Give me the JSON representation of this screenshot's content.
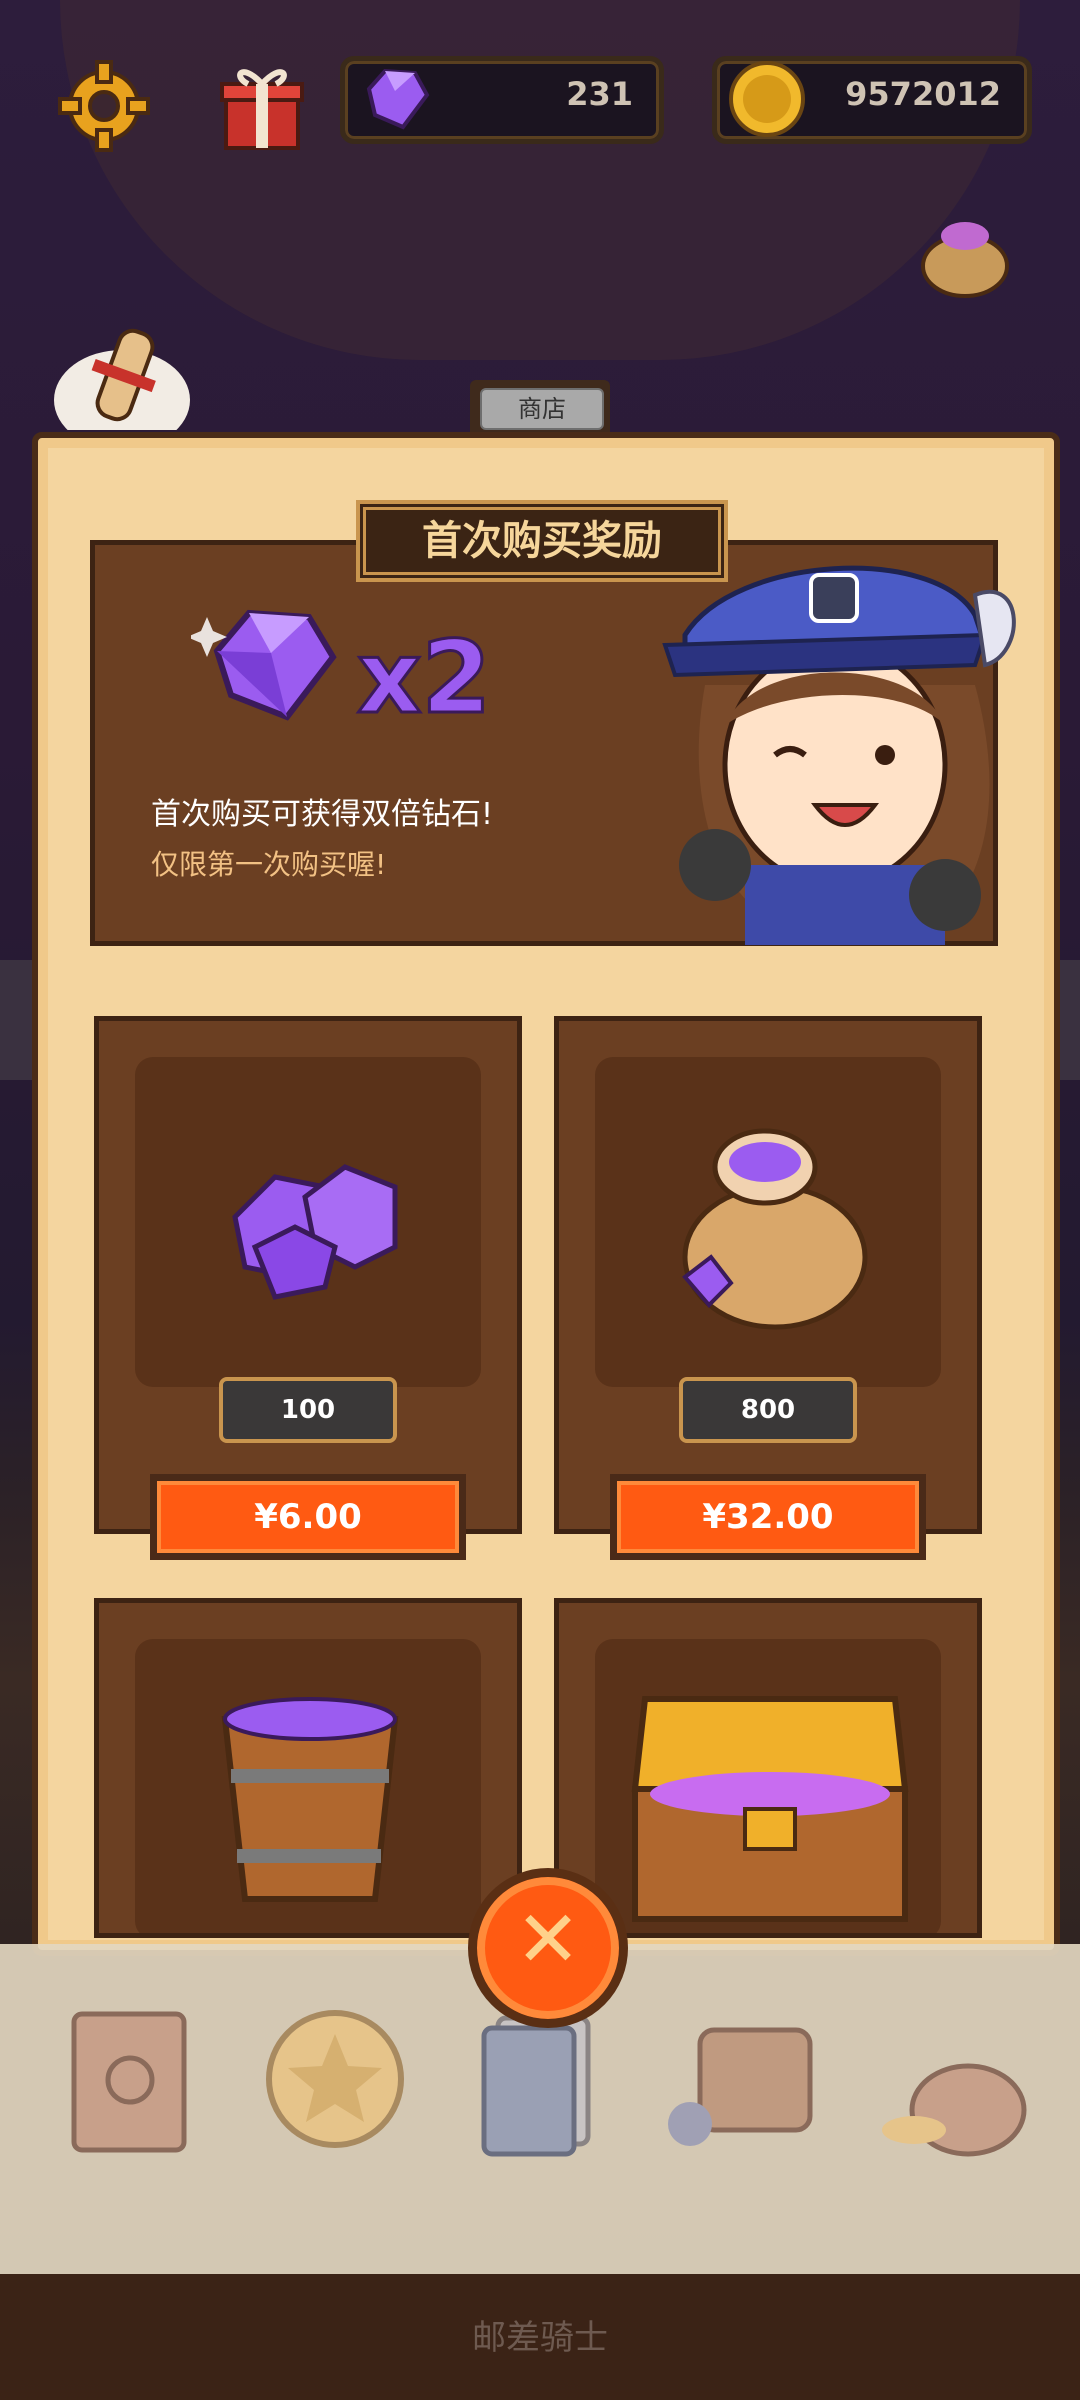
{
  "hud": {
    "gems": "231",
    "coins": "9572012"
  },
  "shop": {
    "tab_label": "商店",
    "bonus": {
      "title": "首次购买奖励",
      "multiplier": "x2",
      "line1": "首次购买可获得双倍钻石!",
      "line2": "仅限第一次购买喔!"
    },
    "items": [
      {
        "amount": "100",
        "price": "¥6.00"
      },
      {
        "amount": "800",
        "price": "¥32.00"
      }
    ]
  },
  "footer": {
    "title": "邮差骑士"
  },
  "colors": {
    "accent": "#ff5a12",
    "gem": "#9b5cf0",
    "panel": "#f4d59f",
    "dark_wood": "#6b3f22"
  },
  "icons": [
    "gear-icon",
    "gift-icon",
    "gem-icon",
    "coin-icon",
    "treasure-bag-icon",
    "scroll-icon",
    "close-icon",
    "book-icon",
    "star-coin-icon",
    "card-icon",
    "backpack-icon",
    "gem-bag-icon"
  ]
}
